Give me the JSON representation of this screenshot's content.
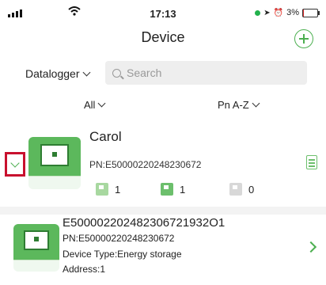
{
  "status_bar": {
    "time": "17:13",
    "battery": "3%",
    "battery_level": 0.03,
    "location_glyph": "➤",
    "alarm_glyph": "⏰",
    "signal_icon": "cellular-signal-icon",
    "wifi_icon": "wifi-icon"
  },
  "header": {
    "title": "Device",
    "add_icon": "plus-circle-icon"
  },
  "toolbar": {
    "type_label": "Datalogger",
    "search_placeholder": "Search"
  },
  "filters": {
    "status_label": "All",
    "sort_label": "Pn A-Z"
  },
  "plant": {
    "name": "Carol",
    "pn": "PN:E50000220248230672",
    "stats": [
      {
        "icon": "online-device-icon",
        "value": "1"
      },
      {
        "icon": "normal-device-icon",
        "value": "1"
      },
      {
        "icon": "offline-device-icon",
        "value": "0"
      }
    ]
  },
  "devices": [
    {
      "serial": "E500002202482306721932O1",
      "pn": "PN:E50000220248230672",
      "type": "Device Type:Energy storage",
      "address": "Address:1"
    }
  ],
  "colors": {
    "accent_green": "#4caf50",
    "highlight_red": "#c8102e"
  }
}
